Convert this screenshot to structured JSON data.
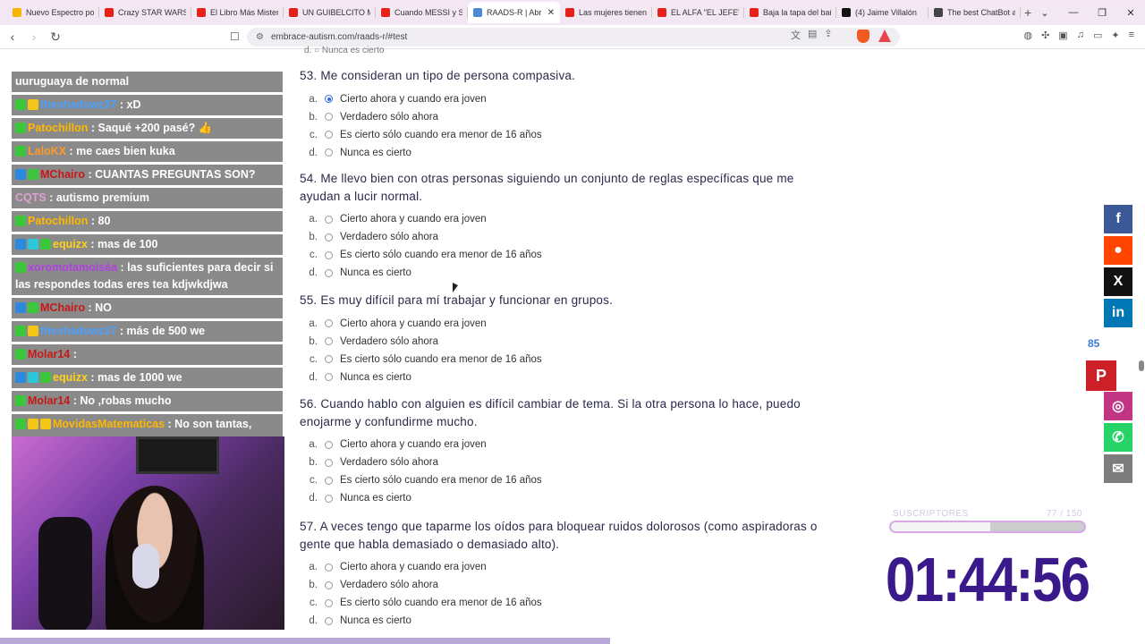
{
  "browser": {
    "tabs": [
      {
        "title": "Nuevo Espectro pol",
        "color": "#f7b500",
        "active": false
      },
      {
        "title": "Crazy STAR WARS Ri",
        "color": "#e62117",
        "active": false
      },
      {
        "title": "El Libro Más Mister",
        "color": "#e62117",
        "active": false
      },
      {
        "title": "UN GUIBELCITO ME",
        "color": "#e62117",
        "active": false
      },
      {
        "title": "Cuando MESSI y SU",
        "color": "#e62117",
        "active": false
      },
      {
        "title": "RAADS-R | Abr",
        "color": "#4a8bd4",
        "active": true
      },
      {
        "title": "Las mujeres tienen",
        "color": "#e62117",
        "active": false
      },
      {
        "title": "EL ALFA \"EL JEFE\" -",
        "color": "#e62117",
        "active": false
      },
      {
        "title": "Baja la tapa del baño",
        "color": "#e62117",
        "active": false
      },
      {
        "title": "(4) Jaime Villalón",
        "color": "#111111",
        "active": false
      },
      {
        "title": "The best ChatBot a",
        "color": "#444444",
        "active": false
      }
    ],
    "url": "embrace-autism.com/raads-r/#test"
  },
  "chat": [
    {
      "user": "",
      "text": "uuruguaya de normal",
      "user_color": "#ffffff",
      "badges": []
    },
    {
      "user": "theshadowz37",
      "text": ": xD",
      "user_color": "#4aa0ff",
      "badges": [
        "#3ac83a",
        "#f5c518"
      ]
    },
    {
      "user": "Patochillon",
      "text": ": Saqué +200 pasé? 👍",
      "user_color": "#ffb700",
      "badges": [
        "#3ac83a"
      ]
    },
    {
      "user": "LaloKX",
      "text": ": me caes bien kuka",
      "user_color": "#ff9a2a",
      "badges": [
        "#3ac83a"
      ]
    },
    {
      "user": "MChairo",
      "text": ": CUANTAS PREGUNTAS SON?",
      "user_color": "#c71818",
      "badges": [
        "#2a8adf",
        "#3ac83a"
      ]
    },
    {
      "user": "CQTS",
      "text": ": autismo premium",
      "user_color": "#e0a0d0",
      "badges": []
    },
    {
      "user": "Patochillon",
      "text": ": 80",
      "user_color": "#ffb700",
      "badges": [
        "#3ac83a"
      ]
    },
    {
      "user": "equizx",
      "text": ": mas de 100",
      "user_color": "#ffd21a",
      "badges": [
        "#2a8adf",
        "#2ac8d8",
        "#3ac83a"
      ]
    },
    {
      "user": "xoromotamoiséa",
      "text": ": las suficientes para decir si las respondes todas eres tea kdjwkdjwa",
      "user_color": "#b040e0",
      "badges": [
        "#3ac83a"
      ]
    },
    {
      "user": "MChairo",
      "text": ": NO",
      "user_color": "#c71818",
      "badges": [
        "#2a8adf",
        "#3ac83a"
      ]
    },
    {
      "user": "theshadowz37",
      "text": ": más de 500 we",
      "user_color": "#4aa0ff",
      "badges": [
        "#3ac83a",
        "#f5c518"
      ]
    },
    {
      "user": "Molar14",
      "text": ":",
      "user_color": "#c71818",
      "badges": [
        "#3ac83a"
      ]
    },
    {
      "user": "equizx",
      "text": ": mas de 1000 we",
      "user_color": "#ffd21a",
      "badges": [
        "#2a8adf",
        "#2ac8d8",
        "#3ac83a"
      ]
    },
    {
      "user": "Molar14",
      "text": ": No ,robas mucho",
      "user_color": "#c71818",
      "badges": [
        "#3ac83a"
      ]
    },
    {
      "user": "MovidasMatematicas",
      "text": ": No son tantas, tonota",
      "user_color": "#ffb700",
      "badges": [
        "#3ac83a",
        "#f5c518",
        "#f5c518"
      ]
    }
  ],
  "quiz": {
    "cutoff_text": "d.  ○ Nunca es cierto",
    "questions": [
      {
        "num": "53.",
        "text": "Me consideran un tipo de persona compasiva.",
        "selected": 0
      },
      {
        "num": "54.",
        "text": "Me llevo bien con otras personas siguiendo un conjunto de reglas específicas que me ayudan a lucir normal.",
        "selected": -1
      },
      {
        "num": "55.",
        "text": "Es muy difícil para mí trabajar y funcionar en grupos.",
        "selected": -1
      },
      {
        "num": "56.",
        "text": "Cuando hablo con alguien es difícil cambiar de tema. Si la otra persona lo hace, puedo enojarme y confundirme mucho.",
        "selected": -1
      },
      {
        "num": "57.",
        "text": "A veces tengo que taparme los oídos para bloquear ruidos dolorosos (como aspiradoras o gente que habla demasiado o demasiado alto).",
        "selected": -1
      }
    ],
    "options": [
      {
        "letter": "a.",
        "text": "Cierto ahora y cuando era joven"
      },
      {
        "letter": "b.",
        "text": "Verdadero sólo ahora"
      },
      {
        "letter": "c.",
        "text": "Es cierto sólo cuando era menor de 16 años"
      },
      {
        "letter": "d.",
        "text": "Nunca es cierto"
      }
    ]
  },
  "social": {
    "share_count": "85",
    "buttons": [
      {
        "name": "facebook",
        "glyph": "f",
        "color": "#3b5998"
      },
      {
        "name": "reddit",
        "glyph": "●",
        "color": "#ff4500"
      },
      {
        "name": "x",
        "glyph": "X",
        "color": "#111111"
      },
      {
        "name": "linkedin",
        "glyph": "in",
        "color": "#0077b5"
      }
    ],
    "pinterest": {
      "glyph": "P",
      "color": "#cb2027"
    },
    "buttons2": [
      {
        "name": "instagram",
        "glyph": "◎",
        "color": "#c13584"
      },
      {
        "name": "whatsapp",
        "glyph": "✆",
        "color": "#25d366"
      },
      {
        "name": "email",
        "glyph": "✉",
        "color": "#7d7d7d"
      }
    ]
  },
  "overlay": {
    "subs_label": "SUSCRIPTORES",
    "subs_count": "77 / 150",
    "subs_fraction": 0.513,
    "timer": "01:44:56"
  }
}
